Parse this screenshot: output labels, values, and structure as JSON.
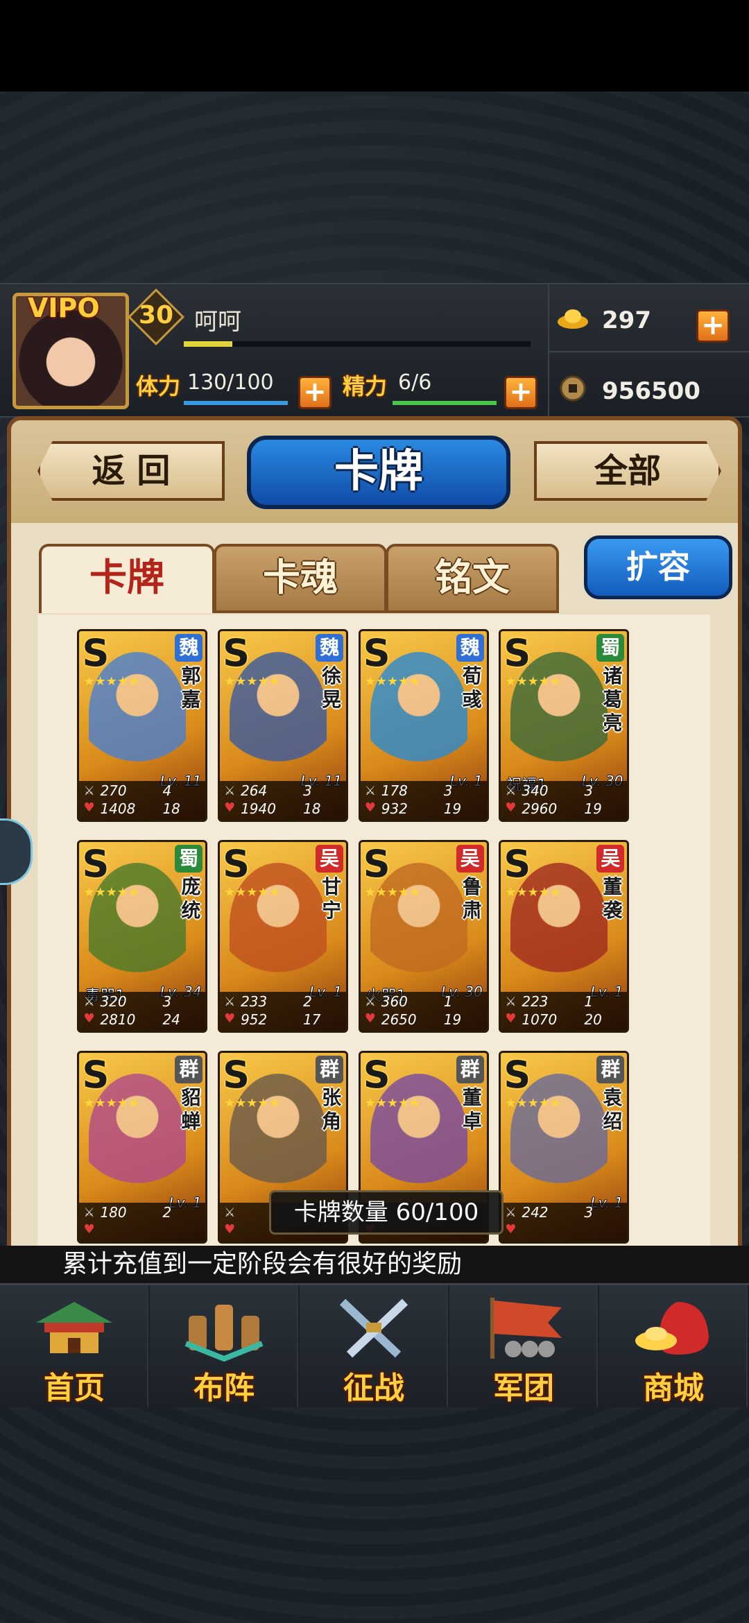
{
  "player": {
    "vip_label": "VIPO",
    "level": "30",
    "name": "呵呵",
    "exp_progress": 0.14
  },
  "stats": {
    "stamina_label": "体力",
    "stamina_value": "130/100",
    "stamina_progress": 1.0,
    "energy_label": "精力",
    "energy_value": "6/6",
    "energy_progress": 1.0,
    "gold": "297",
    "coins": "956500",
    "plus": "+"
  },
  "header": {
    "back_label": "返 回",
    "title": "卡牌",
    "filter_label": "全部"
  },
  "tabs": [
    {
      "label": "卡牌",
      "active": true
    },
    {
      "label": "卡魂",
      "active": false
    },
    {
      "label": "铭文",
      "active": false
    }
  ],
  "expand_label": "扩容",
  "cards": [
    {
      "grade": "S",
      "faction": "魏",
      "name": "郭嘉",
      "skill": "",
      "level": "Lv. 11",
      "atk": "270",
      "atk_r": "4",
      "hp": "1408",
      "hp_r": "18",
      "color": "#4a7fd0"
    },
    {
      "grade": "S",
      "faction": "魏",
      "name": "徐晃",
      "skill": "",
      "level": "Lv. 11",
      "atk": "264",
      "atk_r": "3",
      "hp": "1940",
      "hp_r": "18",
      "color": "#3a5aa0"
    },
    {
      "grade": "S",
      "faction": "魏",
      "name": "荀彧",
      "skill": "",
      "level": "Lv. 1",
      "atk": "178",
      "atk_r": "3",
      "hp": "932",
      "hp_r": "19",
      "color": "#2a8ad0"
    },
    {
      "grade": "S",
      "faction": "蜀",
      "name": "诸葛亮",
      "skill": "祝福1",
      "level": "Lv. 30",
      "atk": "340",
      "atk_r": "3",
      "hp": "2960",
      "hp_r": "19",
      "color": "#3a6a3a"
    },
    {
      "grade": "S",
      "faction": "蜀",
      "name": "庞统",
      "skill": "毒咒1",
      "level": "Lv. 34",
      "atk": "320",
      "atk_r": "3",
      "hp": "2810",
      "hp_r": "24",
      "color": "#4a7a2a"
    },
    {
      "grade": "S",
      "faction": "吴",
      "name": "甘宁",
      "skill": "",
      "level": "Lv. 1",
      "atk": "233",
      "atk_r": "2",
      "hp": "952",
      "hp_r": "17",
      "color": "#c05020"
    },
    {
      "grade": "S",
      "faction": "吴",
      "name": "鲁肃",
      "skill": "火咒1",
      "level": "Lv. 30",
      "atk": "360",
      "atk_r": "1",
      "hp": "2650",
      "hp_r": "19",
      "color": "#c06a20"
    },
    {
      "grade": "S",
      "faction": "吴",
      "name": "董袭",
      "skill": "",
      "level": "Lv. 1",
      "atk": "223",
      "atk_r": "1",
      "hp": "1070",
      "hp_r": "20",
      "color": "#a02a20"
    },
    {
      "grade": "S",
      "faction": "群",
      "name": "貂蝉",
      "skill": "",
      "level": "Lv. 1",
      "atk": "180",
      "atk_r": "2",
      "hp": "",
      "hp_r": "",
      "color": "#b04a8a"
    },
    {
      "grade": "S",
      "faction": "群",
      "name": "张角",
      "skill": "",
      "level": "",
      "atk": "",
      "atk_r": "",
      "hp": "",
      "hp_r": "",
      "color": "#6a5a4a"
    },
    {
      "grade": "S",
      "faction": "群",
      "name": "董卓",
      "skill": "",
      "level": "",
      "atk": "",
      "atk_r": "",
      "hp": "",
      "hp_r": "",
      "color": "#7a4aa0"
    },
    {
      "grade": "S",
      "faction": "群",
      "name": "袁绍",
      "skill": "",
      "level": "Lv. 1",
      "atk": "242",
      "atk_r": "3",
      "hp": "",
      "hp_r": "",
      "color": "#6a6a9a"
    }
  ],
  "faction_colors": {
    "魏": "#2f6fd6",
    "蜀": "#2a8a3a",
    "吴": "#d02a2a",
    "群": "#555555"
  },
  "card_count": "卡牌数量 60/100",
  "ticker_text": "累计充值到一定阶段会有很好的奖励",
  "bottom_nav": [
    {
      "label": "首页",
      "icon": "palace-icon"
    },
    {
      "label": "布阵",
      "icon": "chess-pieces-icon"
    },
    {
      "label": "征战",
      "icon": "crossed-swords-icon"
    },
    {
      "label": "军团",
      "icon": "banner-icon"
    },
    {
      "label": "商城",
      "icon": "treasure-bag-icon"
    }
  ]
}
